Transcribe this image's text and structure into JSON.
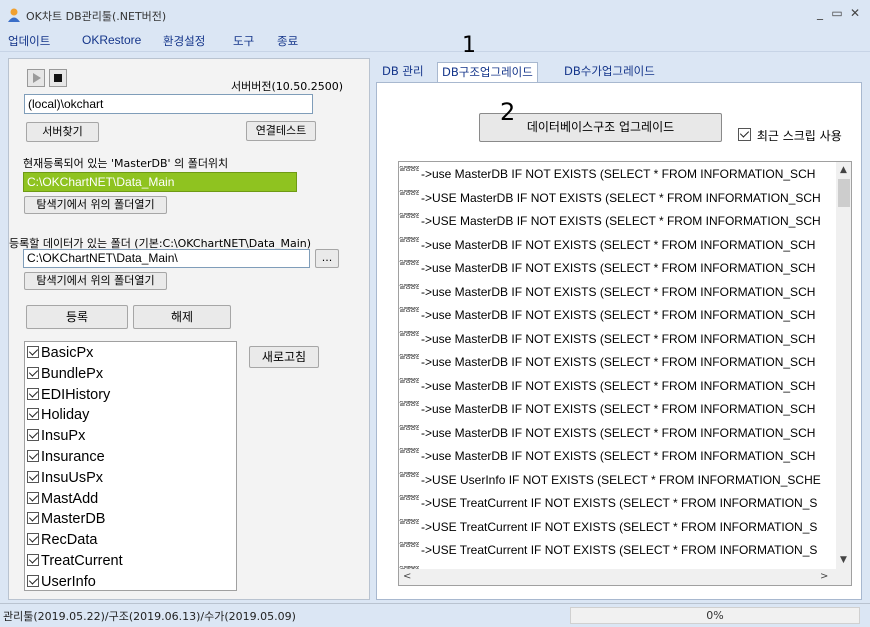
{
  "window": {
    "title": "OK차트 DB관리툴(.NET버전)"
  },
  "menu": [
    "업데이트",
    "OKRestore",
    "환경설정",
    "도구",
    "종료"
  ],
  "left": {
    "server_version": "서버버전(10.50.2500)",
    "server_value": "(local)\\okchart",
    "find_server": "서버찾기",
    "connection_test": "연결테스트",
    "master_label": "현재등록되어 있는 'MasterDB' 의 폴더위치",
    "master_path": "C:\\OKChartNET\\Data_Main",
    "open_in_explorer": "탐색기에서 위의 폴더열기",
    "register_folder_label": "등록할 데이터가 있는 폴더 (기본:C:\\OKChartNET\\Data_Main)",
    "register_folder_value": "C:\\OKChartNET\\Data_Main\\",
    "browse": "...",
    "open_in_explorer_2": "탐색기에서 위의 폴더열기",
    "register": "등록",
    "unregister": "해제",
    "refresh": "새로고침",
    "databases": [
      "BasicPx",
      "BundlePx",
      "EDIHistory",
      "Holiday",
      "InsuPx",
      "Insurance",
      "InsuUsPx",
      "MastAdd",
      "MasterDB",
      "RecData",
      "TreatCurrent",
      "UserInfo"
    ]
  },
  "tabs": [
    "DB 관리",
    "DB구조업그레이드",
    "DB수가업그레이드"
  ],
  "right": {
    "upgrade_button": "데이터베이스구조 업그레이드",
    "use_recent_script": "최근 스크립 사용",
    "log_prefix": "실행중완료",
    "log_lines": [
      "->use MasterDB IF NOT EXISTS (SELECT * FROM INFORMATION_SCH",
      "->USE MasterDB IF NOT EXISTS (SELECT * FROM INFORMATION_SCH",
      "->USE MasterDB IF NOT EXISTS (SELECT * FROM INFORMATION_SCH",
      "->use MasterDB IF NOT EXISTS (SELECT * FROM INFORMATION_SCH",
      "->use MasterDB IF NOT EXISTS (SELECT * FROM INFORMATION_SCH",
      "->use MasterDB IF NOT EXISTS (SELECT * FROM INFORMATION_SCH",
      "->use MasterDB IF NOT EXISTS (SELECT * FROM INFORMATION_SCH",
      "->use MasterDB IF NOT EXISTS (SELECT * FROM INFORMATION_SCH",
      "->use MasterDB IF NOT EXISTS (SELECT * FROM INFORMATION_SCH",
      "->use MasterDB IF NOT EXISTS (SELECT * FROM INFORMATION_SCH",
      "->use MasterDB IF NOT EXISTS (SELECT * FROM INFORMATION_SCH",
      "->use MasterDB IF NOT EXISTS (SELECT * FROM INFORMATION_SCH",
      "->use MasterDB IF NOT EXISTS (SELECT * FROM INFORMATION_SCH",
      "->USE UserInfo IF NOT EXISTS (SELECT * FROM INFORMATION_SCHE",
      "->USE TreatCurrent IF NOT EXISTS (SELECT * FROM INFORMATION_S",
      "->USE TreatCurrent IF NOT EXISTS (SELECT * FROM INFORMATION_S",
      "->USE TreatCurrent IF NOT EXISTS (SELECT * FROM INFORMATION_S",
      "->USE TreatCurrent IF NOT EXISTS (SELECT * FROM INFORMATION_S"
    ]
  },
  "annotations": [
    "1",
    "2"
  ],
  "status": {
    "text": "관리툴(2019.05.22)/구조(2019.06.13)/수가(2019.05.09)",
    "progress_percent": 0,
    "progress_label": "0%"
  },
  "colors": {
    "master_path_bg": "#8fc320",
    "progress": "#06b025",
    "menu_text": "#14358a"
  }
}
